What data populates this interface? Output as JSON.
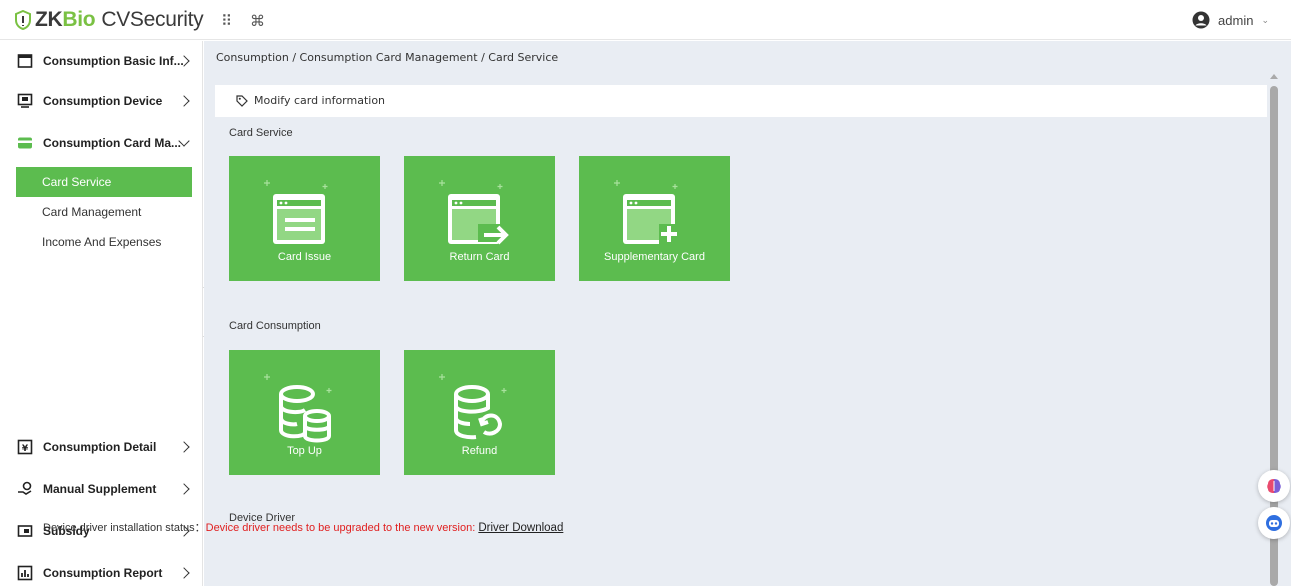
{
  "app": {
    "brand_zk": "ZK",
    "brand_bio": "Bio",
    "brand_product": "CVSecurity"
  },
  "header": {
    "apps_icon": "⠿",
    "command_icon": "⌘",
    "user": "admin"
  },
  "sidebar": {
    "menus": [
      {
        "label": "Consumption Basic Inf...",
        "icon": "calendar-icon"
      },
      {
        "label": "Consumption Device",
        "icon": "device-icon"
      },
      {
        "label": "Consumption Card Ma...",
        "icon": "card-icon",
        "expanded": true
      },
      {
        "label": "Consumption Detail",
        "icon": "yen-doc-icon"
      },
      {
        "label": "Manual Supplement",
        "icon": "hand-coin-icon"
      },
      {
        "label": "Subsidy",
        "icon": "wallet-icon"
      },
      {
        "label": "Consumption Report",
        "icon": "report-icon"
      }
    ],
    "submenu": [
      "Card Service",
      "Card Management",
      "Income And Expenses"
    ],
    "active_submenu": "Card Service",
    "collapse_icon": "«"
  },
  "main": {
    "breadcrumb": "Consumption / Consumption Card Management / Card Service",
    "toolbar": {
      "modify_label": "Modify card information"
    },
    "sections": {
      "card_service": "Card Service",
      "card_consumption": "Card Consumption",
      "device_driver": "Device Driver"
    },
    "tiles": {
      "card_issue": "Card Issue",
      "return_card": "Return Card",
      "supplementary_card": "Supplementary Card",
      "top_up": "Top Up",
      "refund": "Refund"
    },
    "driver": {
      "status_label": "Device driver installation status：",
      "status_message": "Device driver needs to be upgraded to the new version: ",
      "download_link": "Driver Download"
    }
  },
  "colors": {
    "accent": "#5cbc4f",
    "brand_green": "#7ac143",
    "warning": "#e02020",
    "content_bg": "#e9edf3"
  }
}
